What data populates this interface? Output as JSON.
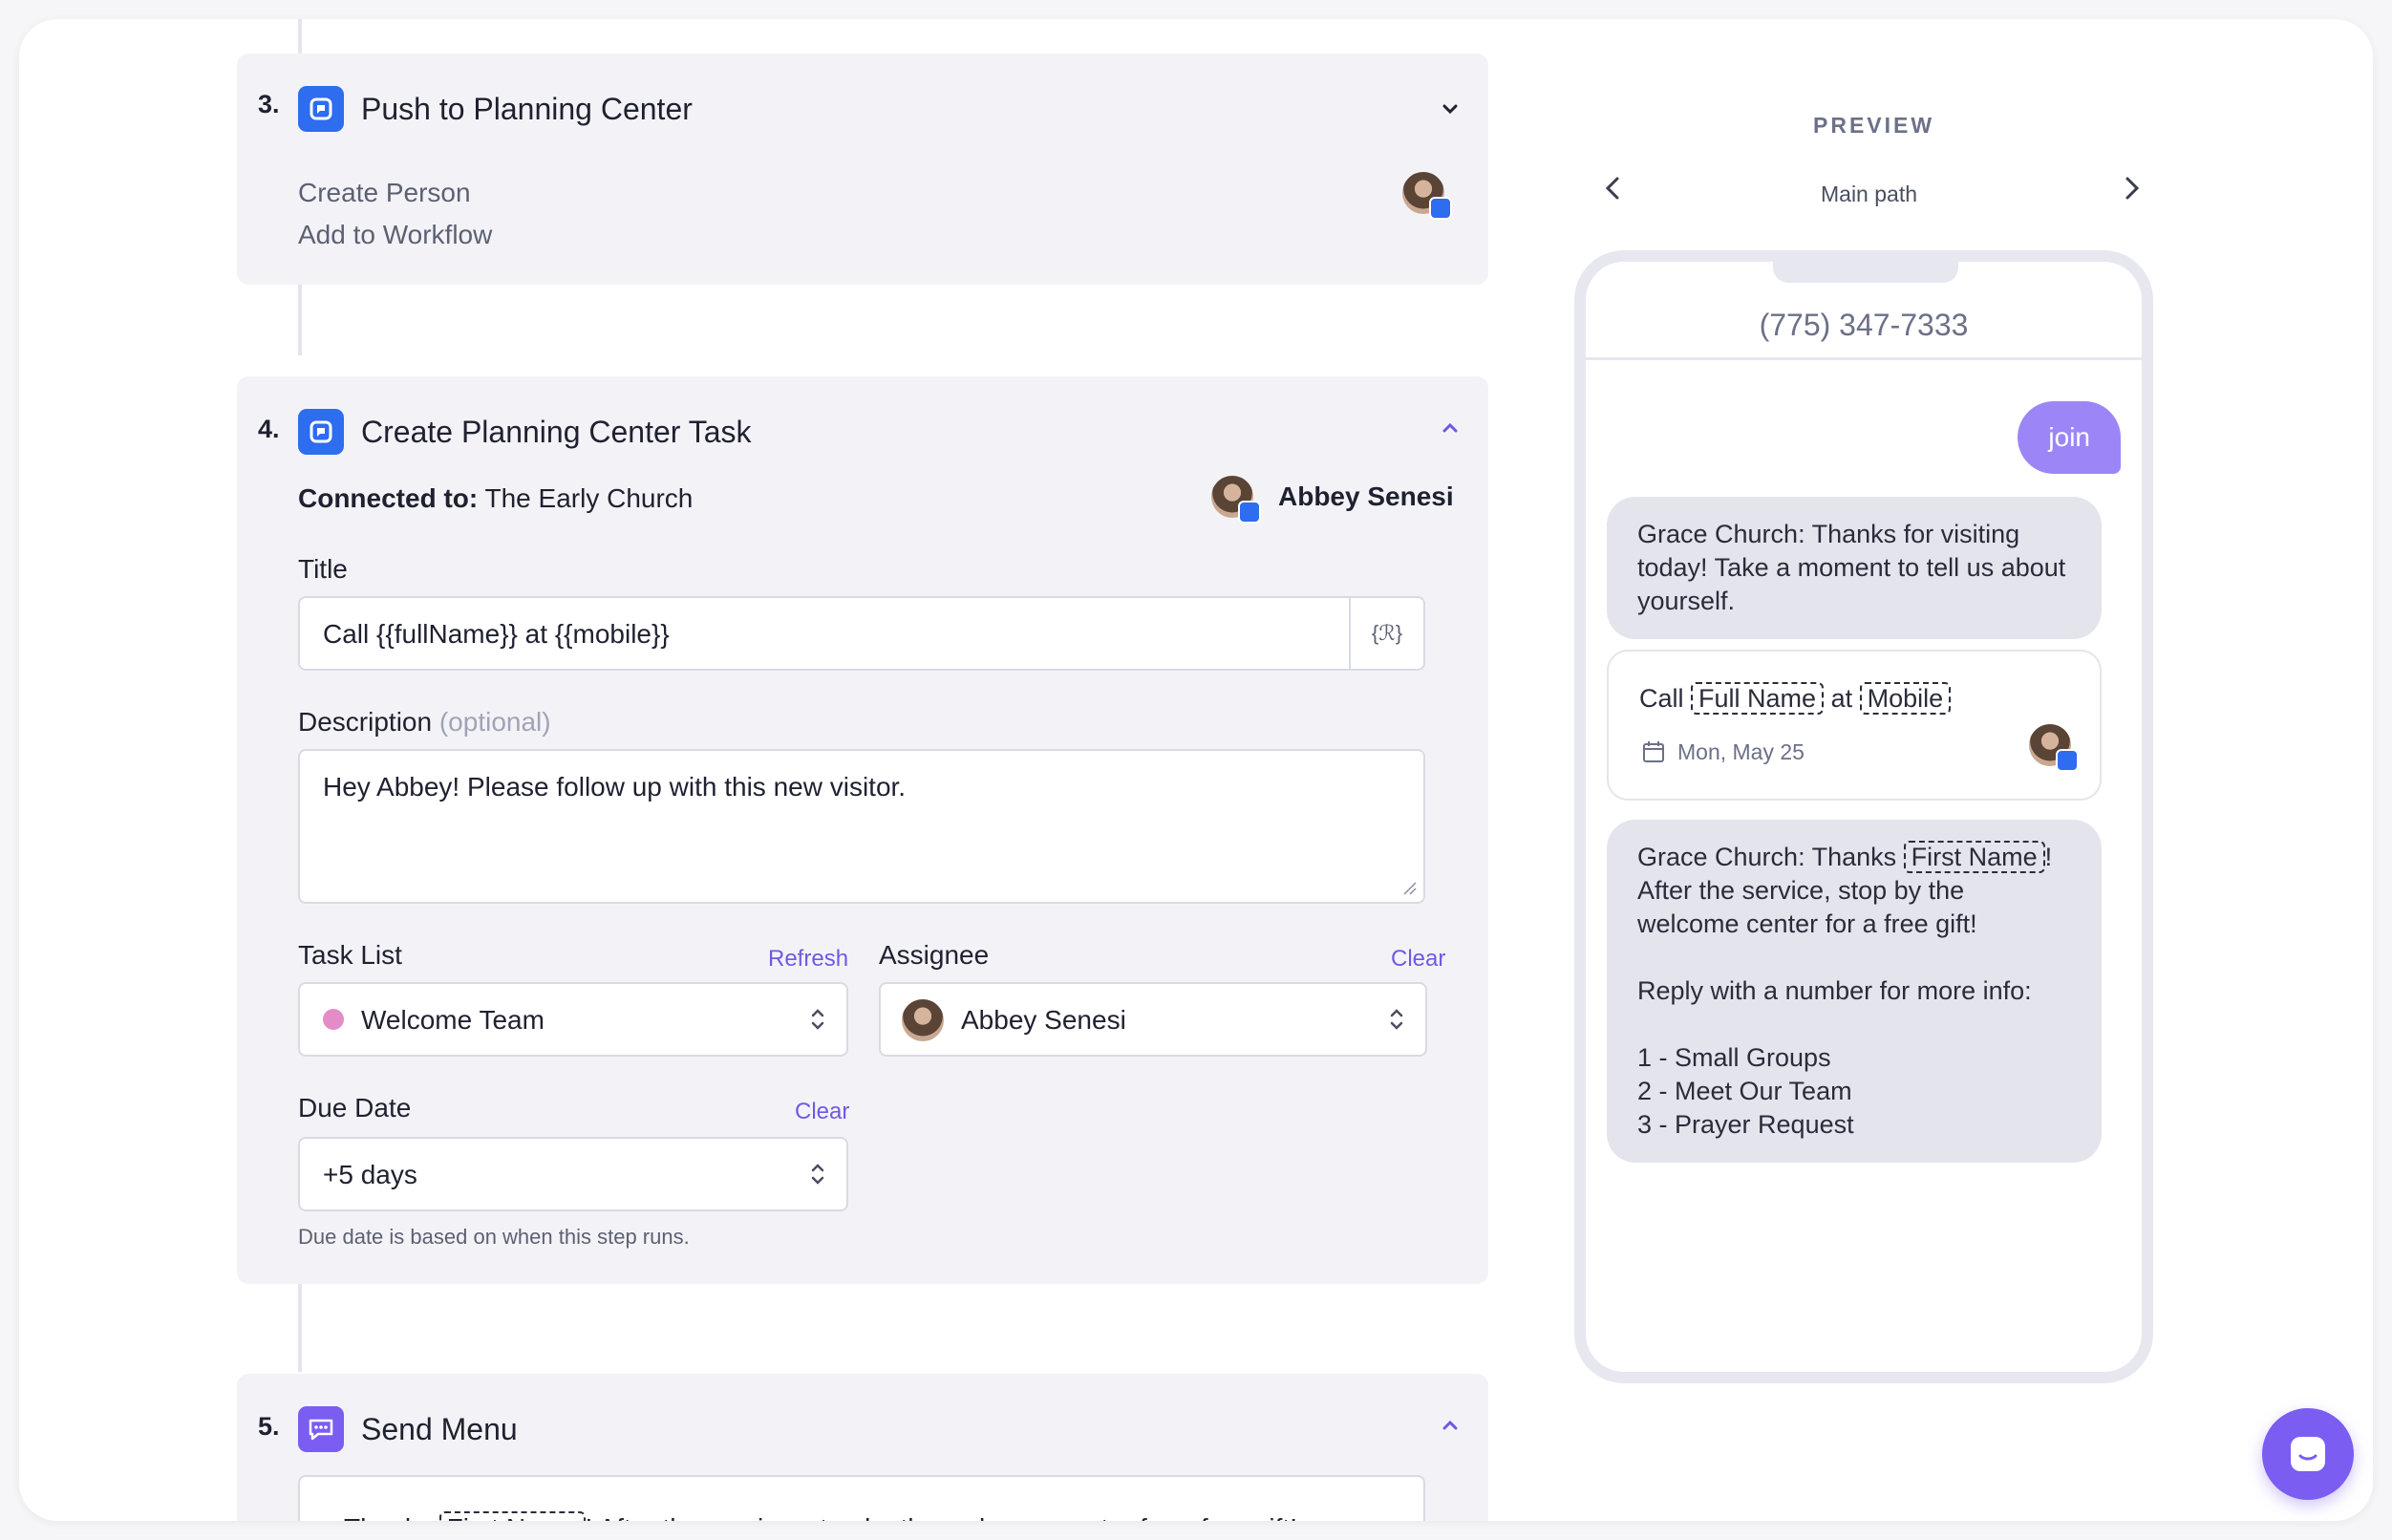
{
  "steps": {
    "step3": {
      "number": "3.",
      "title": "Push to Planning Center",
      "actions": [
        "Create Person",
        "Add to Workflow"
      ]
    },
    "step4": {
      "number": "4.",
      "title": "Create Planning Center Task",
      "connected_label": "Connected to:",
      "connected_value": "The Early Church",
      "account_name": "Abbey Senesi",
      "title_label": "Title",
      "title_value": "Call {{fullName}} at {{mobile}}",
      "variable_button": "{ℛ}",
      "description_label": "Description",
      "description_optional": "(optional)",
      "description_value": "Hey Abbey! Please follow up with this new visitor.",
      "task_list_label": "Task List",
      "task_list_action": "Refresh",
      "task_list_value": "Welcome Team",
      "task_list_color": "#e38cc7",
      "assignee_label": "Assignee",
      "assignee_action": "Clear",
      "assignee_value": "Abbey Senesi",
      "due_date_label": "Due Date",
      "due_date_action": "Clear",
      "due_date_value": "+5 days",
      "due_date_hint": "Due date is based on when this step runs."
    },
    "step5": {
      "number": "5.",
      "title": "Send Menu",
      "message_pre": "Thanks",
      "message_token": "First Name",
      "message_post": "! After the service, stop by the welcome center for a free gift!"
    }
  },
  "preview": {
    "label": "PREVIEW",
    "path": "Main path",
    "phone_number": "(775) 347-7333",
    "outgoing": "join",
    "msg1": "Grace Church: Thanks for visiting today! Take a moment to tell us about yourself.",
    "task_call": "Call",
    "task_token1": "Full Name",
    "task_at": "at",
    "task_token2": "Mobile",
    "task_date": "Mon, May 25",
    "msg2_pre": "Grace Church: Thanks",
    "msg2_token": "First Name",
    "msg2_post": "! After the service, stop by the welcome center for a free gift!",
    "msg2_reply": "Reply with a number for more info:",
    "msg2_options": [
      "1 - Small Groups",
      "2 - Meet Our Team",
      "3 - Prayer Request"
    ]
  },
  "colors": {
    "accent": "#7158e2",
    "planning_center_blue": "#2e6cf0",
    "bubble_out": "#9c86f7"
  }
}
